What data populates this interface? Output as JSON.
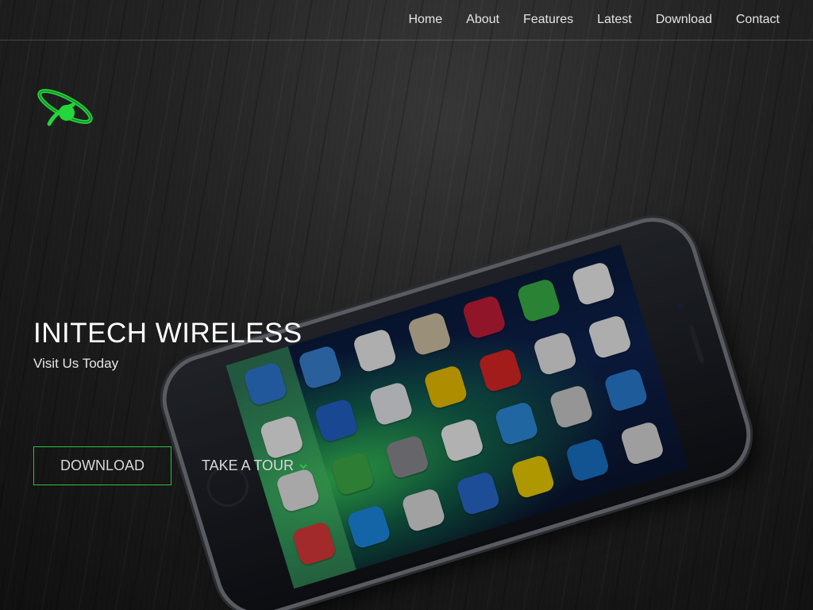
{
  "nav": {
    "items": [
      {
        "label": "Home"
      },
      {
        "label": "About"
      },
      {
        "label": "Features"
      },
      {
        "label": "Latest"
      },
      {
        "label": "Download"
      },
      {
        "label": "Contact"
      }
    ]
  },
  "logo": {
    "icon": "orbit-logo-icon",
    "color": "#22d63b"
  },
  "hero": {
    "title": "INITECH WIRELESS",
    "subtitle": "Visit Us Today",
    "download_label": "DOWNLOAD",
    "tour_label": "TAKE A TOUR",
    "tour_icon": "chevron-down-icon"
  },
  "colors": {
    "accent": "#2fbf45",
    "text": "#e4e4e4"
  }
}
